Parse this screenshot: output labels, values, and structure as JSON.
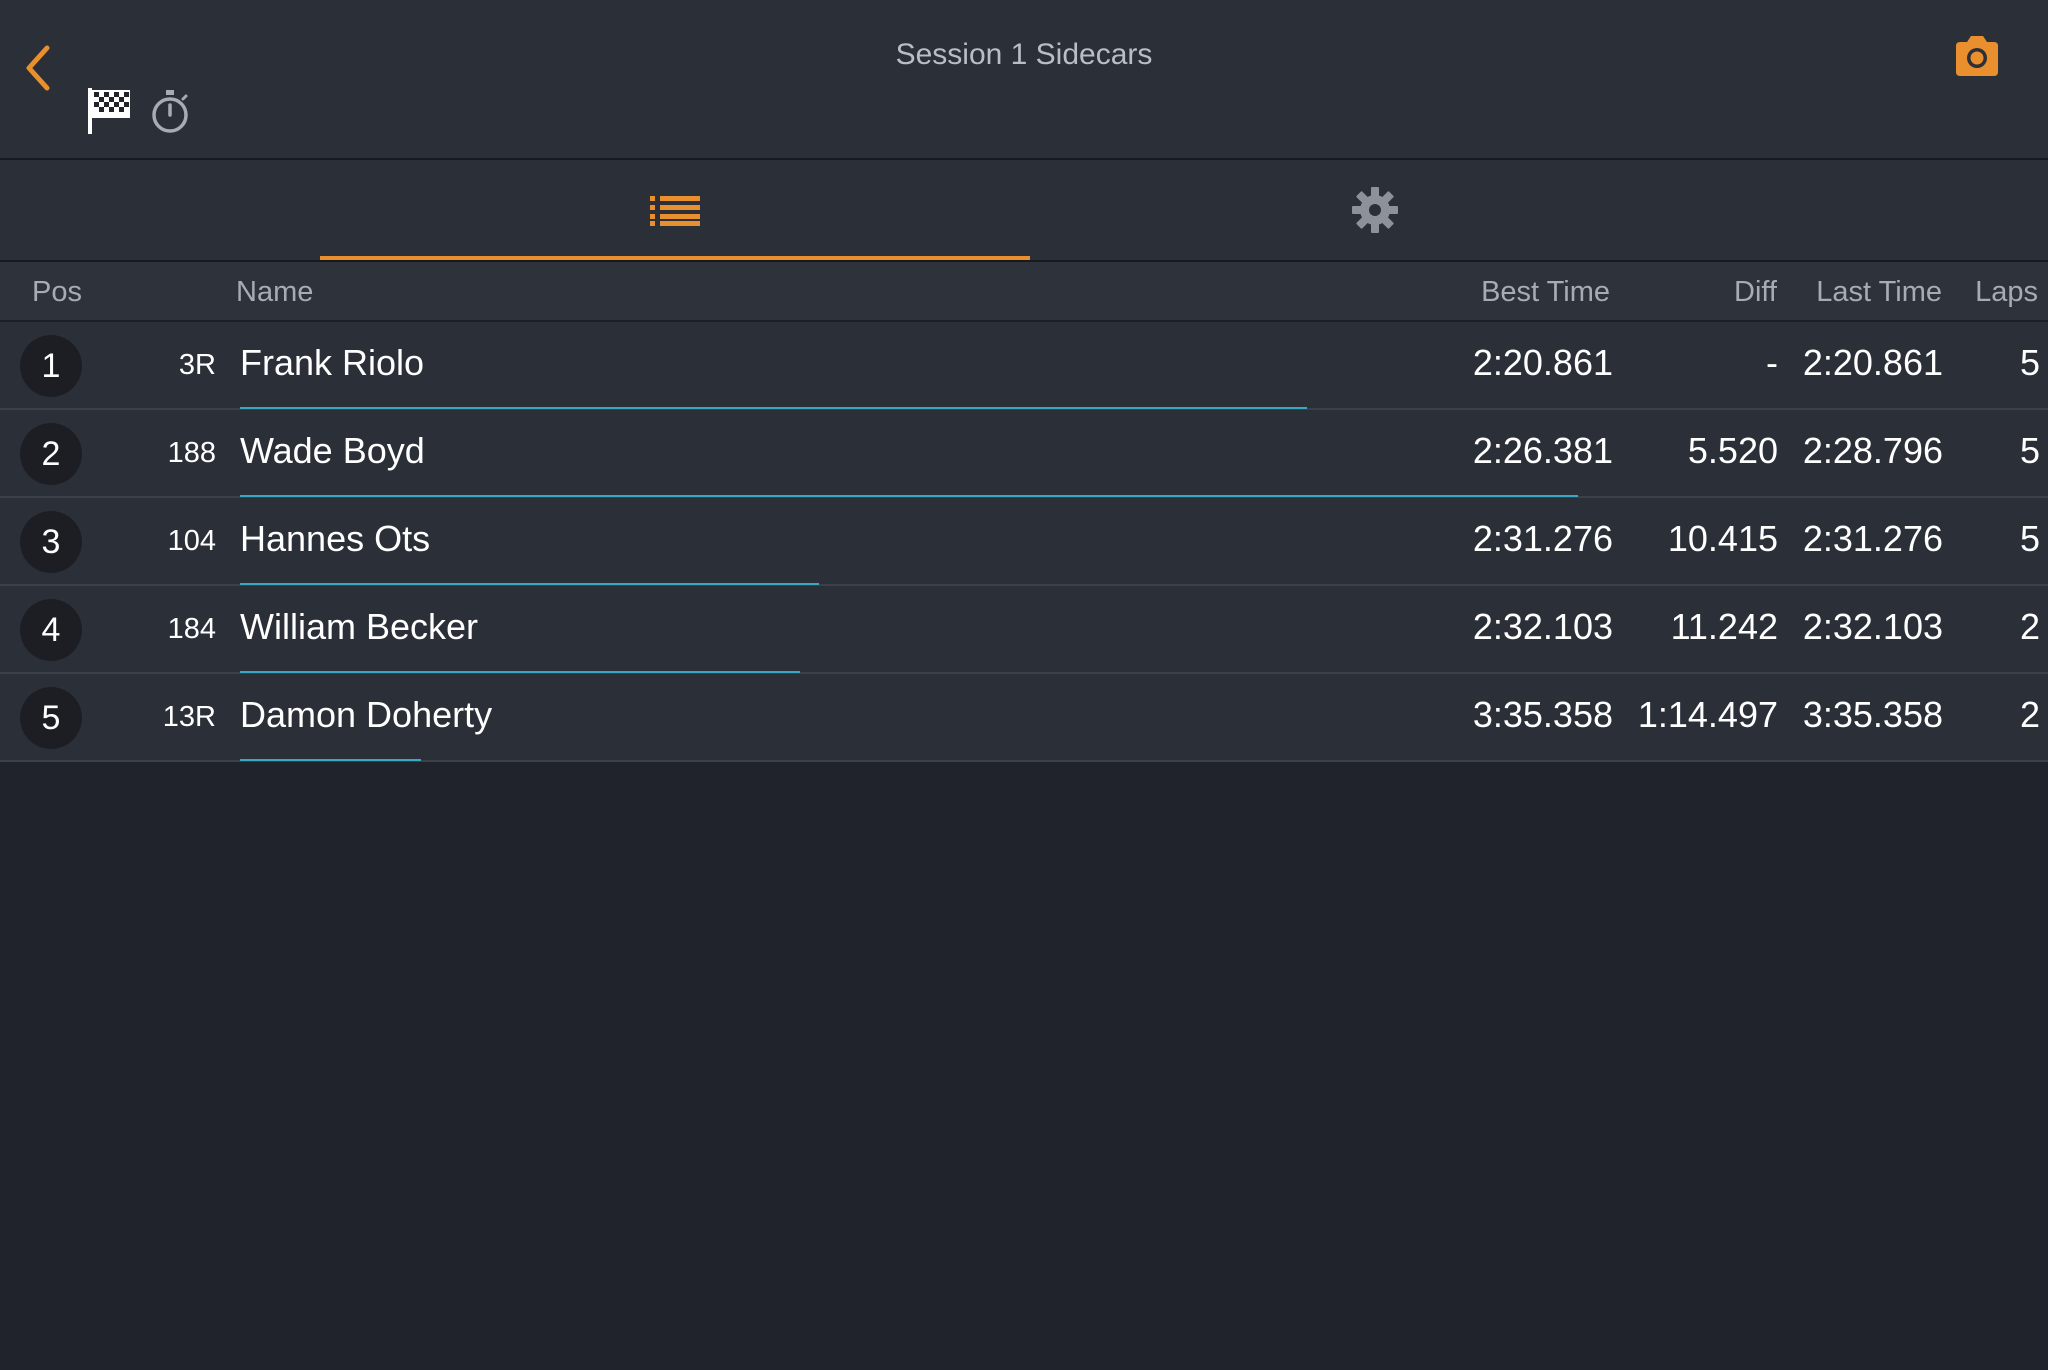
{
  "header": {
    "title": "Session 1 Sidecars",
    "back_icon": "chevron-left-icon",
    "flag_icon": "checkered-flag-icon",
    "timer_icon": "stopwatch-icon",
    "camera_icon": "camera-icon"
  },
  "tabs": [
    {
      "icon": "list-icon",
      "active": true
    },
    {
      "icon": "gear-icon",
      "active": false
    }
  ],
  "columns": {
    "pos": "Pos",
    "name": "Name",
    "best": "Best Time",
    "diff": "Diff",
    "last": "Last Time",
    "laps": "Laps"
  },
  "rows": [
    {
      "pos": "1",
      "number": "3R",
      "name": "Frank Riolo",
      "best": "2:20.861",
      "diff": "-",
      "last": "2:20.861",
      "laps": "5",
      "progress": 0.59
    },
    {
      "pos": "2",
      "number": "188",
      "name": "Wade Boyd",
      "best": "2:26.381",
      "diff": "5.520",
      "last": "2:28.796",
      "laps": "5",
      "progress": 0.74
    },
    {
      "pos": "3",
      "number": "104",
      "name": "Hannes Ots",
      "best": "2:31.276",
      "diff": "10.415",
      "last": "2:31.276",
      "laps": "5",
      "progress": 0.32
    },
    {
      "pos": "4",
      "number": "184",
      "name": "William Becker",
      "best": "2:32.103",
      "diff": "11.242",
      "last": "2:32.103",
      "laps": "2",
      "progress": 0.31
    },
    {
      "pos": "5",
      "number": "13R",
      "name": "Damon Doherty",
      "best": "3:35.358",
      "diff": "1:14.497",
      "last": "3:35.358",
      "laps": "2",
      "progress": 0.1
    }
  ],
  "colors": {
    "accent": "#e98f2e",
    "progress": "#3aa8c4",
    "background": "#20232c",
    "panel": "#2b2f38"
  }
}
